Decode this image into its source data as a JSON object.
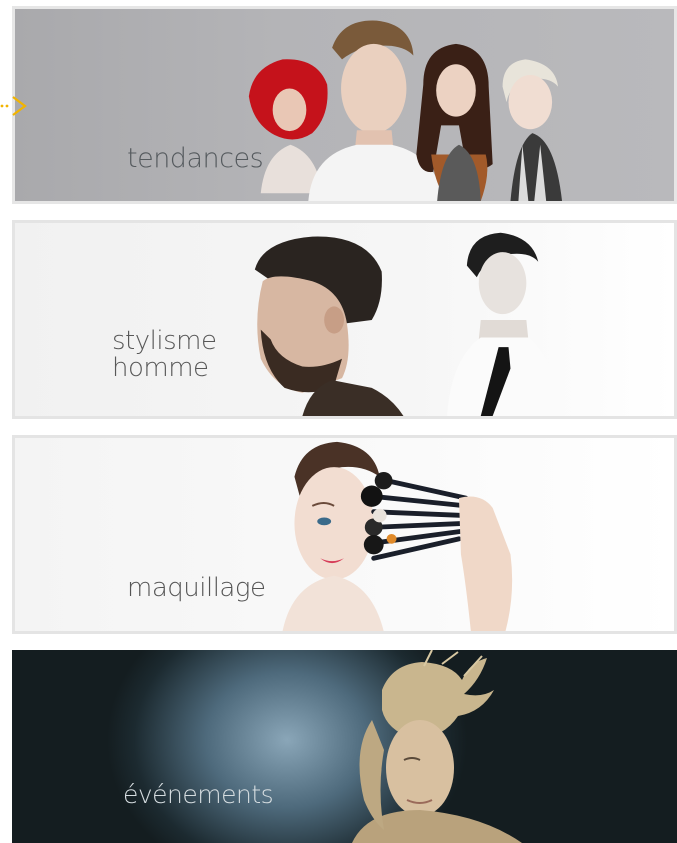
{
  "banners": [
    {
      "label": "tendances",
      "accent": "#e11b1b"
    },
    {
      "label_lines": [
        "stylisme",
        "homme"
      ]
    },
    {
      "label": "maquillage"
    },
    {
      "label": "événements"
    }
  ],
  "arrow": {
    "icon": "chevron-right-icon",
    "color": "#f2b400"
  }
}
